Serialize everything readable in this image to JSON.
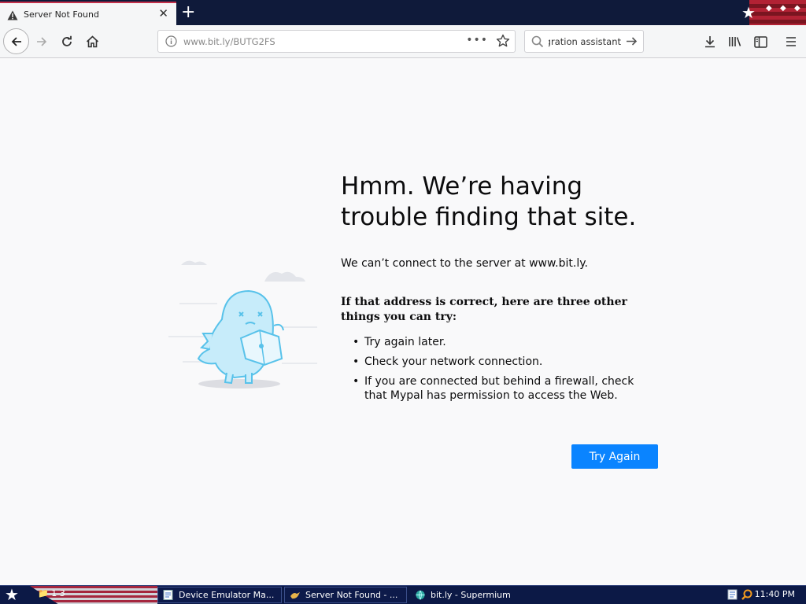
{
  "window": {
    "tab_title": "Server Not Found"
  },
  "navbar": {
    "url": "www.bit.ly/BUTG2FS",
    "search_text": "Integration assistant"
  },
  "error_page": {
    "title": "Hmm. We’re having trouble finding that site.",
    "description": "We can’t connect to the server at www.bit.ly.",
    "tips_heading": "If that address is correct, here are three other things you can try:",
    "tips": [
      "Try again later.",
      "Check your network connection.",
      "If you are connected but behind a firewall, check that Mypal has permission to access the Web."
    ],
    "button_label": "Try Again"
  },
  "taskbar": {
    "folder_label": "1 3",
    "items": [
      {
        "label": "Device Emulator Ma...",
        "icon": "document-icon"
      },
      {
        "label": "Server Not Found - ...",
        "icon": "bird-icon"
      },
      {
        "label": "bit.ly - Supermium",
        "icon": "globe-icon"
      }
    ],
    "clock": "11:40 PM"
  },
  "colors": {
    "accent": "#0a84ff",
    "taskbar": "#0c1946",
    "tab_accent": "#c4314b",
    "illustration": "#58c2ea"
  }
}
